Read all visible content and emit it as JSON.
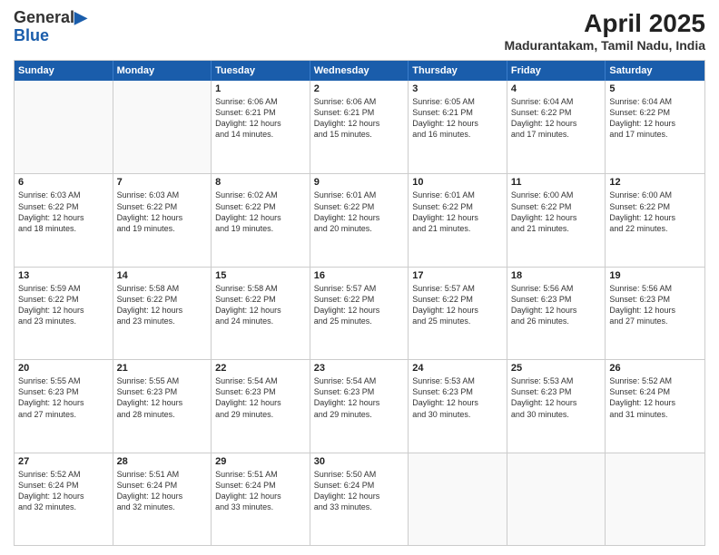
{
  "logo": {
    "general": "General",
    "blue": "Blue"
  },
  "title": {
    "month_year": "April 2025",
    "location": "Madurantakam, Tamil Nadu, India"
  },
  "calendar": {
    "headers": [
      "Sunday",
      "Monday",
      "Tuesday",
      "Wednesday",
      "Thursday",
      "Friday",
      "Saturday"
    ],
    "weeks": [
      [
        {
          "day": "",
          "lines": [],
          "empty": true
        },
        {
          "day": "",
          "lines": [],
          "empty": true
        },
        {
          "day": "1",
          "lines": [
            "Sunrise: 6:06 AM",
            "Sunset: 6:21 PM",
            "Daylight: 12 hours",
            "and 14 minutes."
          ]
        },
        {
          "day": "2",
          "lines": [
            "Sunrise: 6:06 AM",
            "Sunset: 6:21 PM",
            "Daylight: 12 hours",
            "and 15 minutes."
          ]
        },
        {
          "day": "3",
          "lines": [
            "Sunrise: 6:05 AM",
            "Sunset: 6:21 PM",
            "Daylight: 12 hours",
            "and 16 minutes."
          ]
        },
        {
          "day": "4",
          "lines": [
            "Sunrise: 6:04 AM",
            "Sunset: 6:22 PM",
            "Daylight: 12 hours",
            "and 17 minutes."
          ]
        },
        {
          "day": "5",
          "lines": [
            "Sunrise: 6:04 AM",
            "Sunset: 6:22 PM",
            "Daylight: 12 hours",
            "and 17 minutes."
          ]
        }
      ],
      [
        {
          "day": "6",
          "lines": [
            "Sunrise: 6:03 AM",
            "Sunset: 6:22 PM",
            "Daylight: 12 hours",
            "and 18 minutes."
          ]
        },
        {
          "day": "7",
          "lines": [
            "Sunrise: 6:03 AM",
            "Sunset: 6:22 PM",
            "Daylight: 12 hours",
            "and 19 minutes."
          ]
        },
        {
          "day": "8",
          "lines": [
            "Sunrise: 6:02 AM",
            "Sunset: 6:22 PM",
            "Daylight: 12 hours",
            "and 19 minutes."
          ]
        },
        {
          "day": "9",
          "lines": [
            "Sunrise: 6:01 AM",
            "Sunset: 6:22 PM",
            "Daylight: 12 hours",
            "and 20 minutes."
          ]
        },
        {
          "day": "10",
          "lines": [
            "Sunrise: 6:01 AM",
            "Sunset: 6:22 PM",
            "Daylight: 12 hours",
            "and 21 minutes."
          ]
        },
        {
          "day": "11",
          "lines": [
            "Sunrise: 6:00 AM",
            "Sunset: 6:22 PM",
            "Daylight: 12 hours",
            "and 21 minutes."
          ]
        },
        {
          "day": "12",
          "lines": [
            "Sunrise: 6:00 AM",
            "Sunset: 6:22 PM",
            "Daylight: 12 hours",
            "and 22 minutes."
          ]
        }
      ],
      [
        {
          "day": "13",
          "lines": [
            "Sunrise: 5:59 AM",
            "Sunset: 6:22 PM",
            "Daylight: 12 hours",
            "and 23 minutes."
          ]
        },
        {
          "day": "14",
          "lines": [
            "Sunrise: 5:58 AM",
            "Sunset: 6:22 PM",
            "Daylight: 12 hours",
            "and 23 minutes."
          ]
        },
        {
          "day": "15",
          "lines": [
            "Sunrise: 5:58 AM",
            "Sunset: 6:22 PM",
            "Daylight: 12 hours",
            "and 24 minutes."
          ]
        },
        {
          "day": "16",
          "lines": [
            "Sunrise: 5:57 AM",
            "Sunset: 6:22 PM",
            "Daylight: 12 hours",
            "and 25 minutes."
          ]
        },
        {
          "day": "17",
          "lines": [
            "Sunrise: 5:57 AM",
            "Sunset: 6:22 PM",
            "Daylight: 12 hours",
            "and 25 minutes."
          ]
        },
        {
          "day": "18",
          "lines": [
            "Sunrise: 5:56 AM",
            "Sunset: 6:23 PM",
            "Daylight: 12 hours",
            "and 26 minutes."
          ]
        },
        {
          "day": "19",
          "lines": [
            "Sunrise: 5:56 AM",
            "Sunset: 6:23 PM",
            "Daylight: 12 hours",
            "and 27 minutes."
          ]
        }
      ],
      [
        {
          "day": "20",
          "lines": [
            "Sunrise: 5:55 AM",
            "Sunset: 6:23 PM",
            "Daylight: 12 hours",
            "and 27 minutes."
          ]
        },
        {
          "day": "21",
          "lines": [
            "Sunrise: 5:55 AM",
            "Sunset: 6:23 PM",
            "Daylight: 12 hours",
            "and 28 minutes."
          ]
        },
        {
          "day": "22",
          "lines": [
            "Sunrise: 5:54 AM",
            "Sunset: 6:23 PM",
            "Daylight: 12 hours",
            "and 29 minutes."
          ]
        },
        {
          "day": "23",
          "lines": [
            "Sunrise: 5:54 AM",
            "Sunset: 6:23 PM",
            "Daylight: 12 hours",
            "and 29 minutes."
          ]
        },
        {
          "day": "24",
          "lines": [
            "Sunrise: 5:53 AM",
            "Sunset: 6:23 PM",
            "Daylight: 12 hours",
            "and 30 minutes."
          ]
        },
        {
          "day": "25",
          "lines": [
            "Sunrise: 5:53 AM",
            "Sunset: 6:23 PM",
            "Daylight: 12 hours",
            "and 30 minutes."
          ]
        },
        {
          "day": "26",
          "lines": [
            "Sunrise: 5:52 AM",
            "Sunset: 6:24 PM",
            "Daylight: 12 hours",
            "and 31 minutes."
          ]
        }
      ],
      [
        {
          "day": "27",
          "lines": [
            "Sunrise: 5:52 AM",
            "Sunset: 6:24 PM",
            "Daylight: 12 hours",
            "and 32 minutes."
          ]
        },
        {
          "day": "28",
          "lines": [
            "Sunrise: 5:51 AM",
            "Sunset: 6:24 PM",
            "Daylight: 12 hours",
            "and 32 minutes."
          ]
        },
        {
          "day": "29",
          "lines": [
            "Sunrise: 5:51 AM",
            "Sunset: 6:24 PM",
            "Daylight: 12 hours",
            "and 33 minutes."
          ]
        },
        {
          "day": "30",
          "lines": [
            "Sunrise: 5:50 AM",
            "Sunset: 6:24 PM",
            "Daylight: 12 hours",
            "and 33 minutes."
          ]
        },
        {
          "day": "",
          "lines": [],
          "empty": true
        },
        {
          "day": "",
          "lines": [],
          "empty": true
        },
        {
          "day": "",
          "lines": [],
          "empty": true
        }
      ]
    ]
  }
}
